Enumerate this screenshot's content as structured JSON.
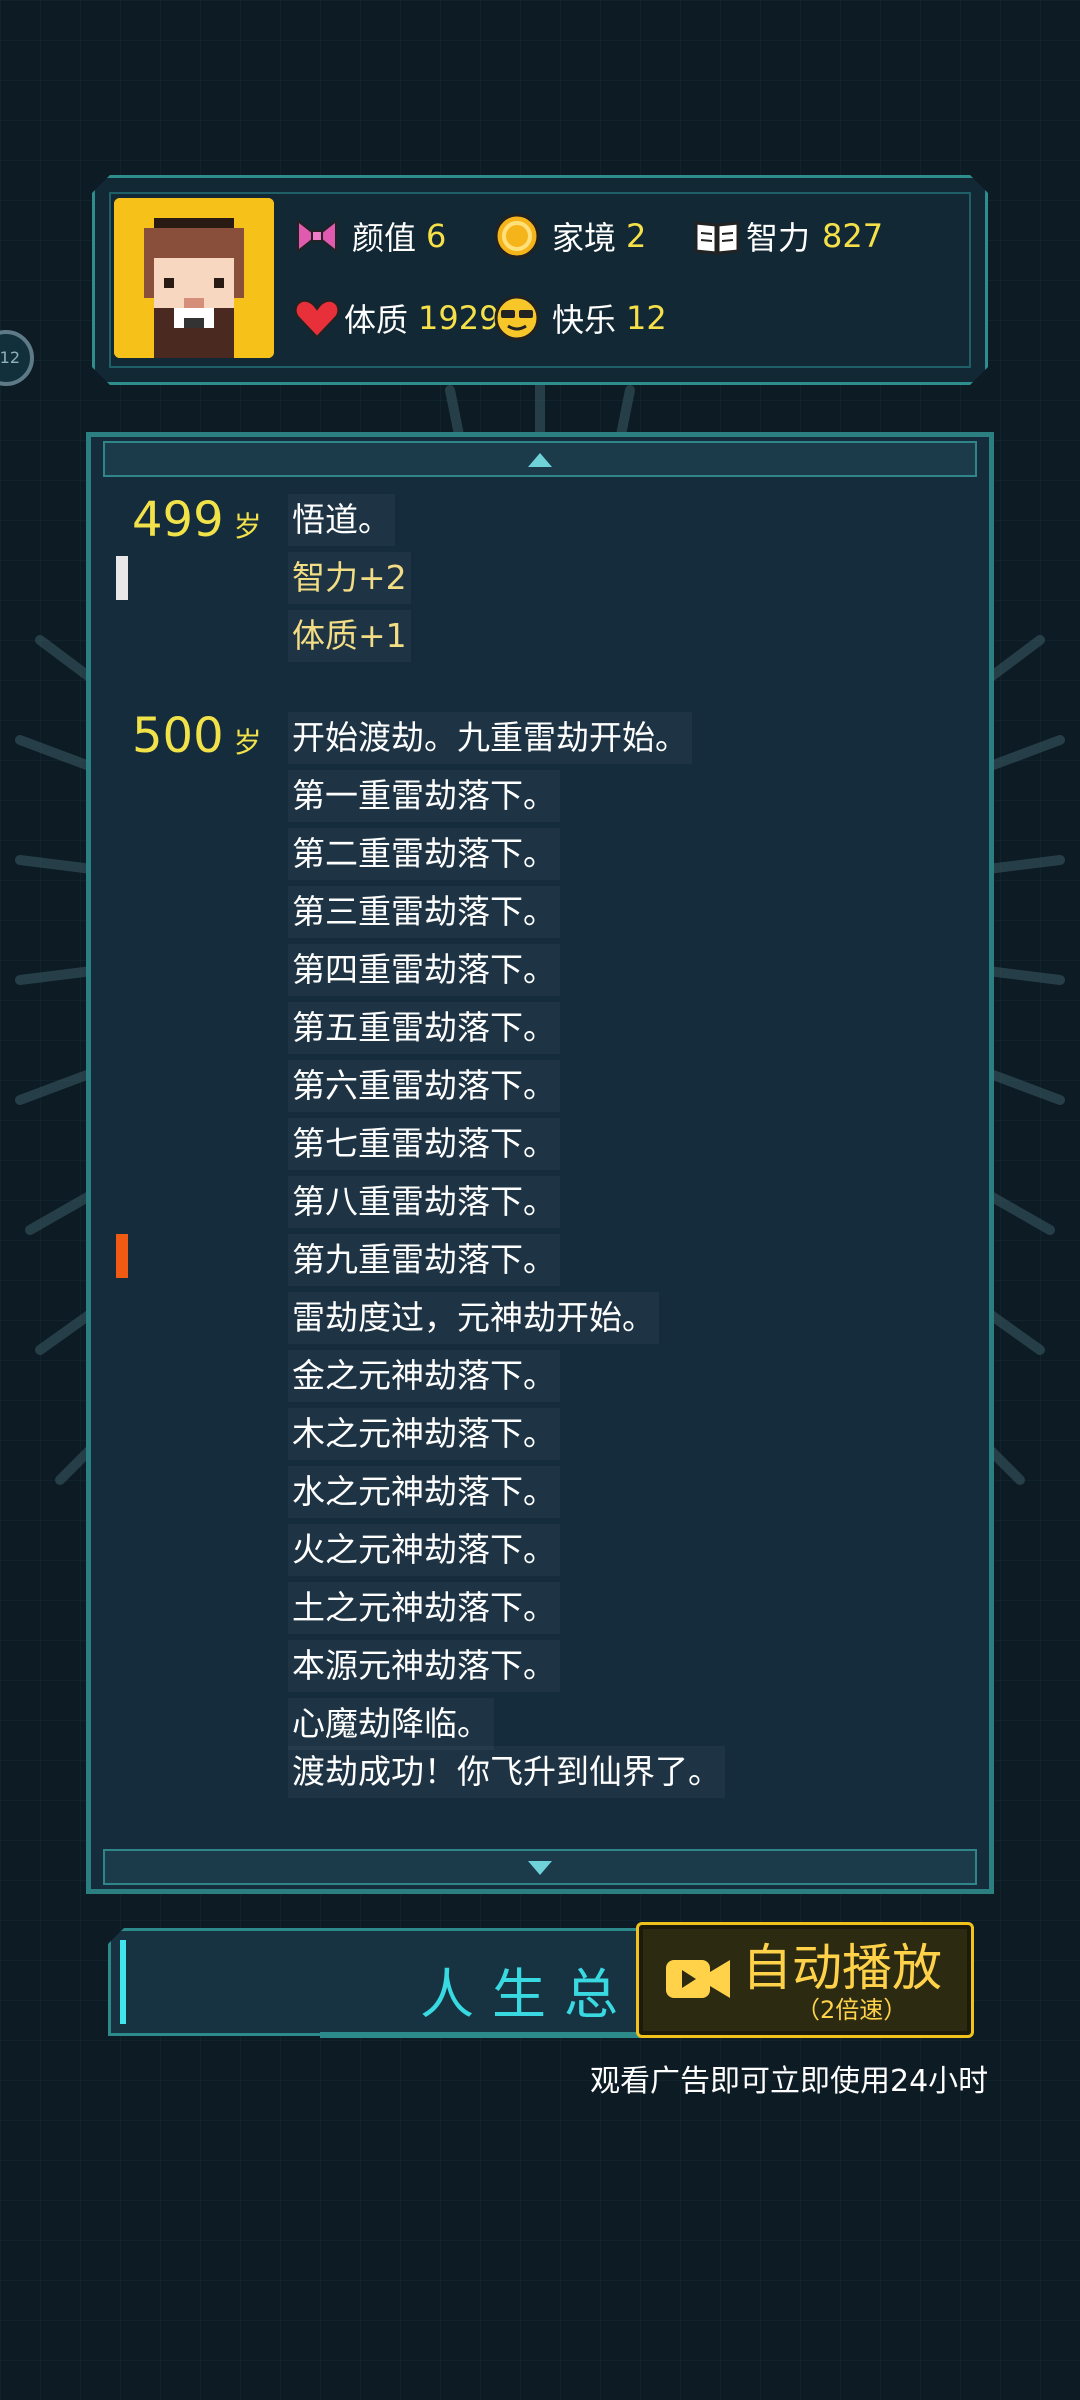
{
  "stats": {
    "appearance": {
      "label": "颜值",
      "value": "6"
    },
    "family": {
      "label": "家境",
      "value": "2"
    },
    "intelligence": {
      "label": "智力",
      "value": "827"
    },
    "physique": {
      "label": "体质",
      "value": "1929"
    },
    "happiness": {
      "label": "快乐",
      "value": "12"
    }
  },
  "side_handle": {
    "text": "12"
  },
  "log": [
    {
      "age": "499",
      "unit": "岁",
      "lines": [
        {
          "text": "悟道。",
          "style": "normal"
        },
        {
          "text": "智力+2",
          "style": "gold"
        },
        {
          "text": "体质+1",
          "style": "gold"
        }
      ]
    },
    {
      "age": "500",
      "unit": "岁",
      "lines": [
        {
          "text": "开始渡劫。九重雷劫开始。",
          "style": "normal"
        },
        {
          "text": "第一重雷劫落下。",
          "style": "normal"
        },
        {
          "text": "第二重雷劫落下。",
          "style": "normal"
        },
        {
          "text": "第三重雷劫落下。",
          "style": "normal"
        },
        {
          "text": "第四重雷劫落下。",
          "style": "normal"
        },
        {
          "text": "第五重雷劫落下。",
          "style": "normal"
        },
        {
          "text": "第六重雷劫落下。",
          "style": "normal"
        },
        {
          "text": "第七重雷劫落下。",
          "style": "normal"
        },
        {
          "text": "第八重雷劫落下。",
          "style": "normal"
        },
        {
          "text": "第九重雷劫落下。",
          "style": "normal"
        },
        {
          "text": "雷劫度过，元神劫开始。",
          "style": "normal"
        },
        {
          "text": "金之元神劫落下。",
          "style": "normal"
        },
        {
          "text": "木之元神劫落下。",
          "style": "normal"
        },
        {
          "text": "水之元神劫落下。",
          "style": "normal"
        },
        {
          "text": "火之元神劫落下。",
          "style": "normal"
        },
        {
          "text": "土之元神劫落下。",
          "style": "normal"
        },
        {
          "text": "本源元神劫落下。",
          "style": "normal"
        },
        {
          "text": "心魔劫降临。",
          "style": "normal"
        },
        {
          "text": "渡劫成功！你飞升到仙界了。",
          "style": "normal"
        }
      ]
    }
  ],
  "buttons": {
    "summary": "人生总结",
    "auto_play": "自动播放",
    "auto_play_sub": "（2倍速）"
  },
  "ad_note": "观看广告即可立即使用24小时",
  "colors": {
    "accent_teal": "#2b7f80",
    "value_yellow": "#f5e04a",
    "gold_text": "#f3dd84",
    "marker_white": "#e8e8e8",
    "marker_orange": "#f15a13",
    "auto_border": "#f0c21c"
  },
  "icons": {
    "appearance": "bow-icon",
    "family": "coin-icon",
    "intelligence": "book-icon",
    "physique": "heart-icon",
    "happiness": "sunglasses-face-icon",
    "auto_play": "video-camera-icon"
  }
}
